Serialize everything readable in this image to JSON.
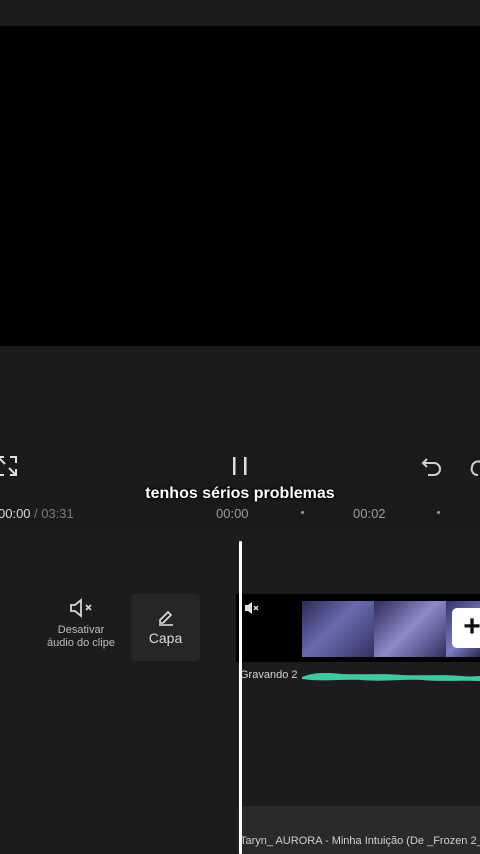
{
  "player": {
    "caption": "tenhos sérios problemas",
    "current_time": "00:00",
    "total_time": "/ 03:31"
  },
  "ruler": {
    "labels": [
      "00:00",
      "00:02"
    ]
  },
  "controls": {
    "mute_label_line1": "Desativar",
    "mute_label_line2": "áudio do clipe",
    "cover_label": "Capa",
    "add_label": "+"
  },
  "tracks": {
    "voice_label": "Gravando 2",
    "music_label": "Taryn_ AURORA - Minha Intuição (De _Frozen 2_"
  },
  "colors": {
    "waveform": "#3fc9a0",
    "background": "#1a1a1a"
  }
}
